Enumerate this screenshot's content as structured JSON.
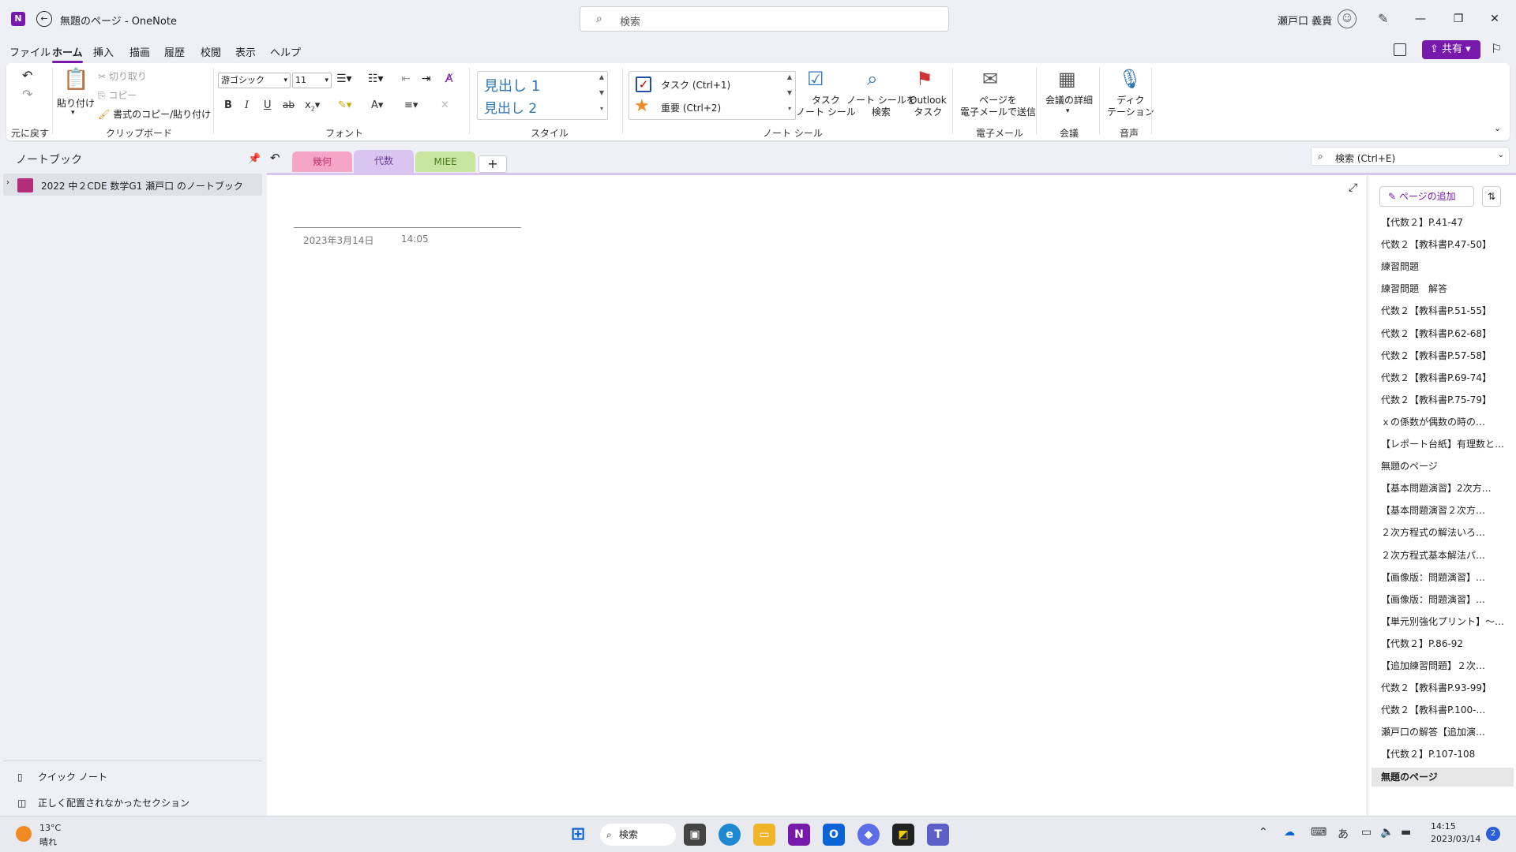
{
  "window": {
    "app_icon_letter": "N",
    "title": "無題のページ  -  OneNote",
    "search_placeholder": "検索",
    "user_name": "瀬戸口 義貴"
  },
  "menu": {
    "tabs": [
      "ファイル",
      "ホーム",
      "挿入",
      "描画",
      "履歴",
      "校閲",
      "表示",
      "ヘルプ"
    ],
    "active_tab": "ホーム",
    "share_label": "共有"
  },
  "ribbon": {
    "undo_group": "元に戻す",
    "clipboard": {
      "paste": "貼り付け",
      "cut": "切り取り",
      "copy": "コピー",
      "format_painter": "書式のコピー/貼り付け",
      "group": "クリップボード"
    },
    "font": {
      "font_name": "游ゴシック",
      "font_size": "11",
      "bold": "B",
      "italic": "I",
      "underline": "U",
      "strike": "ab",
      "subscript": "x",
      "group": "フォント"
    },
    "styles": {
      "heading1": "見出し 1",
      "heading2": "見出し 2",
      "group": "スタイル"
    },
    "tags": {
      "task": "タスク (Ctrl+1)",
      "important": "重要 (Ctrl+2)",
      "todo_tag": "タスク\nノート シール",
      "find_tags": "ノート シールを\n検索",
      "outlook_tasks": "Outlook\nタスク",
      "group": "ノート シール"
    },
    "email": {
      "send": "ページを\n電子メールで送信",
      "group": "電子メール"
    },
    "meetings": {
      "details": "会議の詳細",
      "group": "会議"
    },
    "voice": {
      "dictate": "ディク\nテーション",
      "group": "音声"
    }
  },
  "nav": {
    "title": "ノートブック",
    "notebook": "2022 中２CDE 数学G1 瀬戸口 のノートブック",
    "quick_notes": "クイック ノート",
    "misplaced": "正しく配置されなかったセクション"
  },
  "sections": [
    {
      "label": "幾何",
      "color": "#f5a6c8",
      "text": "#c0306e"
    },
    {
      "label": "代数",
      "color": "#d9c6f0",
      "text": "#6a3a9e"
    },
    {
      "label": "MIEE",
      "color": "#c8e6a0",
      "text": "#4a7a20"
    }
  ],
  "page": {
    "date": "2023年3月14日",
    "time": "14:05"
  },
  "pagelist": {
    "search_label": "検索 (Ctrl+E)",
    "add_page": "ページの追加",
    "pages": [
      "【代数２】P.41-47",
      "代数２【教科書P.47-50】",
      "練習問題",
      "練習問題　解答",
      "代数２【教科書P.51-55】",
      "代数２【教科書P.62-68】",
      "代数２【教科書P.57-58】",
      "代数２【教科書P.69-74】",
      "代数２【教科書P.75-79】",
      "ｘの係数が偶数の時の…",
      "【レポート台紙】有理数と…",
      "無題のページ",
      "【基本問題演習】2次方…",
      "【基本問題演習２次方…",
      "２次方程式の解法いろ…",
      "２次方程式基本解法パ…",
      "【画像版：問題演習】…",
      "【画像版：問題演習】…",
      "【単元別強化プリント】〜…",
      "【代数２】P.86-92",
      "【追加練習問題】２次…",
      "代数２【教科書P.93-99】",
      "代数２【教科書P.100-…",
      "瀬戸口の解答【追加演…",
      "【代数２】P.107-108",
      "無題のページ"
    ],
    "selected_index": 25
  },
  "taskbar": {
    "temp": "13°C",
    "weather": "晴れ",
    "search": "検索",
    "ime": "あ",
    "time": "14:15",
    "date": "2023/03/14",
    "notifications": "2"
  }
}
